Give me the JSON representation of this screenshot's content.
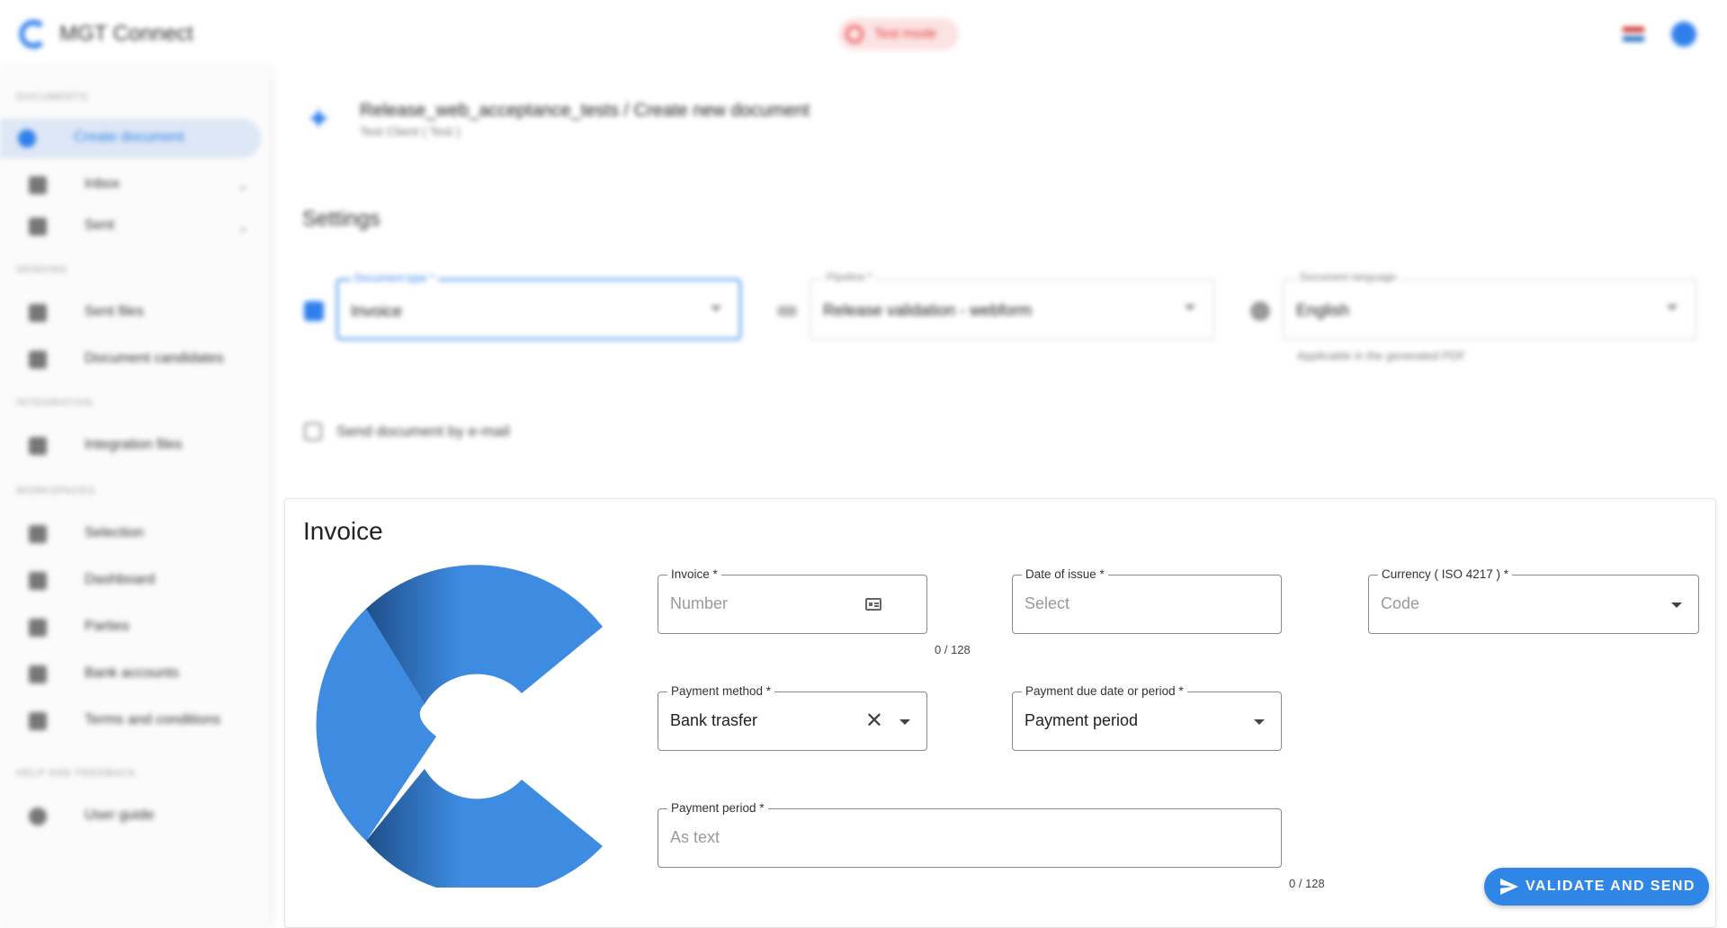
{
  "header": {
    "app_title": "MGT Connect",
    "test_mode_label": "Test mode"
  },
  "sidebar": {
    "sections": [
      {
        "title": "DOCUMENTS"
      },
      {
        "title": "SENDING"
      },
      {
        "title": "INTEGRATION"
      },
      {
        "title": "WORKSPACES"
      },
      {
        "title": "HELP AND FEEDBACK"
      }
    ],
    "items": [
      {
        "label": "Create document"
      },
      {
        "label": "Inbox"
      },
      {
        "label": "Sent"
      },
      {
        "label": "Sent files"
      },
      {
        "label": "Document candidates"
      },
      {
        "label": "Integration files"
      },
      {
        "label": "Selection"
      },
      {
        "label": "Dashboard"
      },
      {
        "label": "Parties"
      },
      {
        "label": "Bank accounts"
      },
      {
        "label": "Terms and conditions"
      },
      {
        "label": "User guide"
      }
    ]
  },
  "breadcrumb": {
    "path": "Release_web_acceptance_tests / Create new document",
    "subtitle": "Test Client ( Test )"
  },
  "settings": {
    "title": "Settings",
    "document_type": {
      "label": "Document type *",
      "value": "Invoice"
    },
    "pipeline": {
      "label": "Pipeline *",
      "value": "Release validation - webform"
    },
    "document_language": {
      "label": "Document language",
      "value": "English",
      "hint": "Applicable in the generated PDF"
    },
    "send_email_label": "Send document by e-mail"
  },
  "invoice": {
    "title": "Invoice",
    "fields": {
      "invoice_number": {
        "label": "Invoice *",
        "placeholder": "Number",
        "counter": "0 / 128"
      },
      "date_of_issue": {
        "label": "Date of issue *",
        "placeholder": "Select"
      },
      "currency": {
        "label": "Currency ( ISO 4217 ) *",
        "placeholder": "Code"
      },
      "payment_method": {
        "label": "Payment method *",
        "value": "Bank trasfer"
      },
      "payment_due": {
        "label": "Payment due date or period *",
        "value": "Payment period"
      },
      "payment_period": {
        "label": "Payment period *",
        "placeholder": "As text",
        "counter": "0 / 128"
      }
    }
  },
  "actions": {
    "validate_send_label": "VALIDATE AND SEND"
  },
  "colors": {
    "accent": "#2f86e6",
    "logo_blue": "#3d8ce2"
  }
}
